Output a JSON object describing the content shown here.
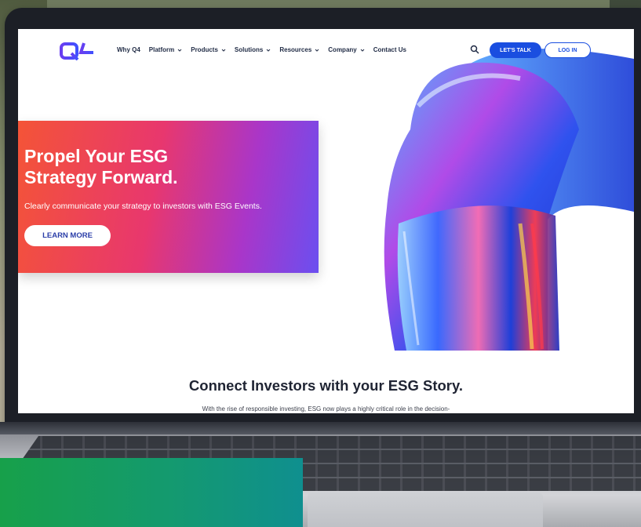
{
  "nav": {
    "items": [
      {
        "label": "Why Q4",
        "has_dropdown": false
      },
      {
        "label": "Platform",
        "has_dropdown": true
      },
      {
        "label": "Products",
        "has_dropdown": true
      },
      {
        "label": "Solutions",
        "has_dropdown": true
      },
      {
        "label": "Resources",
        "has_dropdown": true
      },
      {
        "label": "Company",
        "has_dropdown": true
      },
      {
        "label": "Contact Us",
        "has_dropdown": false
      }
    ],
    "search_icon": "search-icon",
    "cta_talk": "LET'S TALK",
    "cta_login": "LOG IN"
  },
  "hero": {
    "title_line1": "Propel Your ESG",
    "title_line2": "Strategy Forward.",
    "subtitle": "Clearly communicate your strategy to investors with ESG Events.",
    "button": "LEARN MORE"
  },
  "section": {
    "title": "Connect Investors with your ESG Story.",
    "body": "With the rise of responsible investing, ESG now plays a highly critical role in the decision-"
  },
  "colors": {
    "brand_blue": "#1a4ee0",
    "logo_purple": "#6a3df0",
    "hero_start": "#f45437",
    "hero_end": "#6b4ff0",
    "overlay_green": "#17a04a"
  }
}
